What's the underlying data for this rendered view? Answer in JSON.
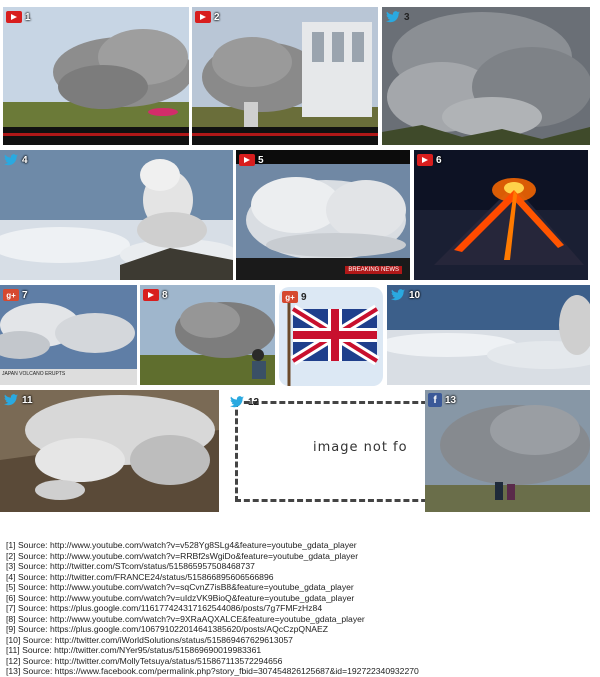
{
  "tiles": [
    {
      "number": "1",
      "icon": "youtube-icon"
    },
    {
      "number": "2",
      "icon": "youtube-icon"
    },
    {
      "number": "3",
      "icon": "twitter-icon"
    },
    {
      "number": "4",
      "icon": "twitter-icon"
    },
    {
      "number": "5",
      "icon": "youtube-icon"
    },
    {
      "number": "6",
      "icon": "youtube-icon"
    },
    {
      "number": "7",
      "icon": "googleplus-icon"
    },
    {
      "number": "8",
      "icon": "youtube-icon"
    },
    {
      "number": "9",
      "icon": "googleplus-icon"
    },
    {
      "number": "10",
      "icon": "twitter-icon"
    },
    {
      "number": "11",
      "icon": "twitter-icon"
    },
    {
      "number": "12",
      "icon": "twitter-icon"
    },
    {
      "number": "13",
      "icon": "facebook-icon"
    }
  ],
  "overlays": {
    "breaking_news": "BREAKING NEWS",
    "japan_volcano": "JAPAN VOLCANO ERUPTS",
    "image_not_found": "image not fo"
  },
  "sources": [
    "[1] Source: http://www.youtube.com/watch?v=v528Yg8SLg4&feature=youtube_gdata_player",
    "[2] Source: http://www.youtube.com/watch?v=RRBf2sWgiDo&feature=youtube_gdata_player",
    "[3] Source: http://twitter.com/STcom/status/515865957508468737",
    "[4] Source: http://twitter.com/FRANCE24/status/515866895606566896",
    "[5] Source: http://www.youtube.com/watch?v=sqCvnZ7isB8&feature=youtube_gdata_player",
    "[6] Source: http://www.youtube.com/watch?v=uIdzVK9BioQ&feature=youtube_gdata_player",
    "[7] Source: https://plus.google.com/116177424317162544086/posts/7g7FMFzHz84",
    "[8] Source: http://www.youtube.com/watch?v=9XRaAQXALCE&feature=youtube_gdata_player",
    "[9] Source: https://plus.google.com/106791022014641385620/posts/AQcCzpQNAEZ",
    "[10] Source: http://twitter.com/iWorldSolutions/status/515869467629613057",
    "[11] Source: http://twitter.com/NYer95/status/515869690019983361",
    "[12] Source: http://twitter.com/MollyTetsuya/status/515867113572294656",
    "[13] Source: https://www.facebook.com/permalink.php?story_fbid=307454826125687&id=192722340932270"
  ]
}
